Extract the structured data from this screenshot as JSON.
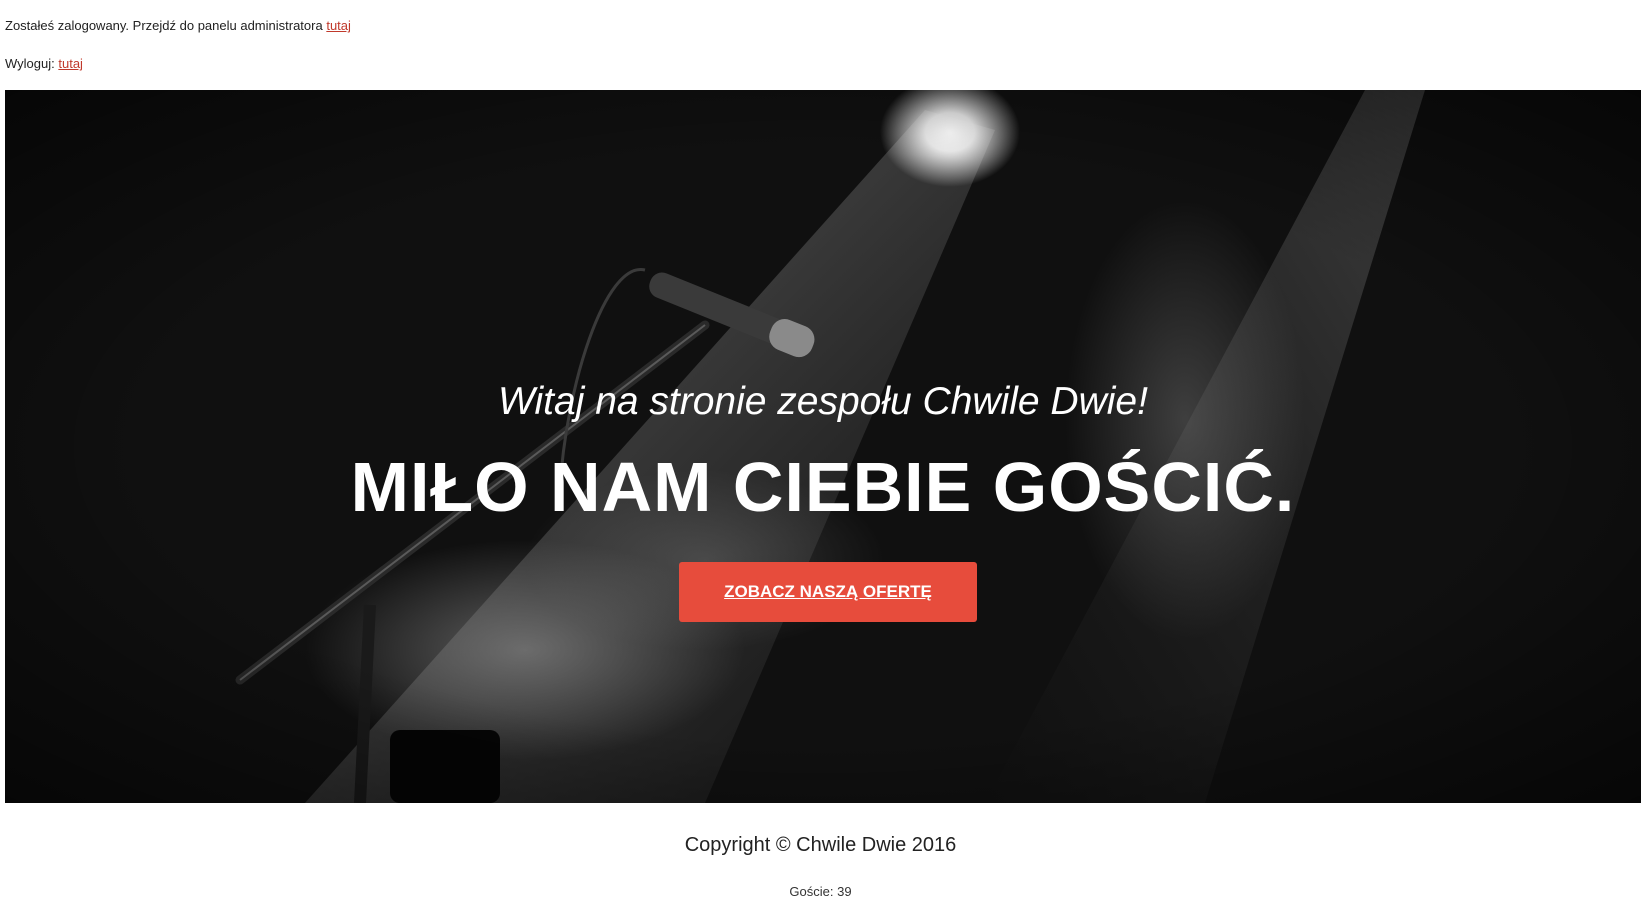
{
  "topbar": {
    "logged_in_text": "Zostałeś zalogowany. Przejdź do panelu administratora ",
    "admin_link": "tutaj",
    "logout_text": "Wyloguj: ",
    "logout_link": "tutaj"
  },
  "hero": {
    "subtitle": "Witaj na stronie zespołu Chwile Dwie!",
    "title": "MIŁO NAM CIEBIE GOŚCIĆ.",
    "cta_label": "ZOBACZ NASZĄ OFERTĘ",
    "background_image": "microphone-on-stage-photo",
    "button_color": "#e74c3c"
  },
  "footer": {
    "copyright": "Copyright © Chwile Dwie 2016",
    "visitors": "Goście: 39"
  }
}
